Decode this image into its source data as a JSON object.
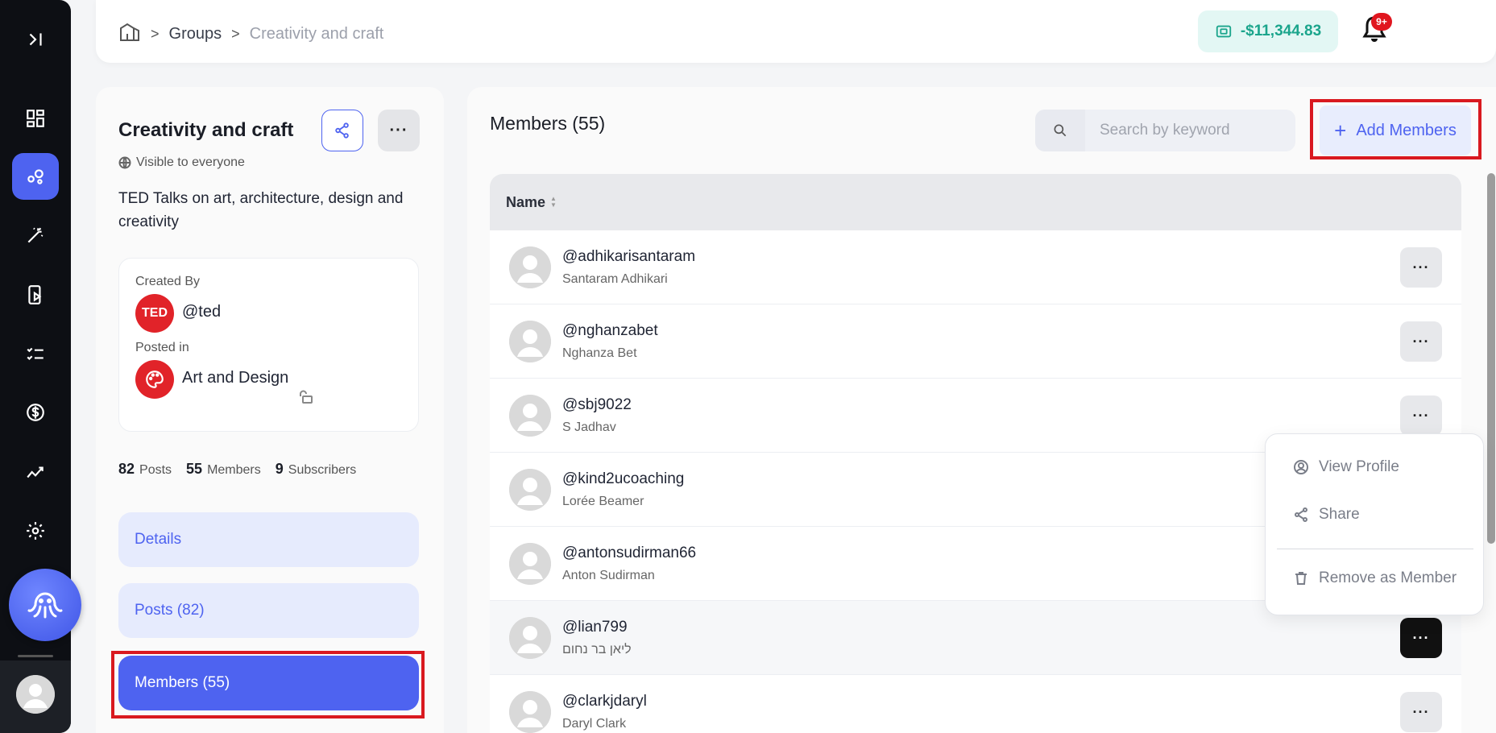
{
  "breadcrumb": {
    "items": [
      {
        "label": "Groups"
      },
      {
        "label": "Creativity and craft"
      }
    ],
    "separator": ">"
  },
  "topbar": {
    "balance": "-$11,344.83",
    "notification_badge": "9+"
  },
  "group": {
    "title": "Creativity and craft",
    "visibility": "Visible to everyone",
    "description": "TED Talks on art, architecture, design and creativity",
    "created_by_label": "Created By",
    "creator_avatar_text": "TED",
    "creator_handle": "@ted",
    "posted_in_label": "Posted in",
    "posted_in": "Art and Design",
    "stats": {
      "posts_count": "82",
      "posts_label": "Posts",
      "members_count": "55",
      "members_label": "Members",
      "subscribers_count": "9",
      "subscribers_label": "Subscribers"
    }
  },
  "nav": {
    "details": "Details",
    "posts": "Posts (82)",
    "members": "Members (55)"
  },
  "members": {
    "title": "Members (55)",
    "search_placeholder": "Search by keyword",
    "add_button": "Add Members",
    "column_name": "Name",
    "rows": [
      {
        "handle": "@adhikarisantaram",
        "name": "Santaram Adhikari"
      },
      {
        "handle": "@nghanzabet",
        "name": "Nghanza Bet"
      },
      {
        "handle": "@sbj9022",
        "name": "S Jadhav"
      },
      {
        "handle": "@kind2ucoaching",
        "name": "Lorée Beamer"
      },
      {
        "handle": "@antonsudirman66",
        "name": "Anton Sudirman"
      },
      {
        "handle": "@lian799",
        "name": "ליאן בר נחום"
      },
      {
        "handle": "@clarkjdaryl",
        "name": "Daryl Clark"
      }
    ]
  },
  "context_menu": {
    "view_profile": "View Profile",
    "share": "Share",
    "remove": "Remove as Member"
  },
  "colors": {
    "accent": "#4e63f0",
    "balance": "#1ba58c",
    "highlight": "#d9191f",
    "rail": "#0d0f14"
  }
}
